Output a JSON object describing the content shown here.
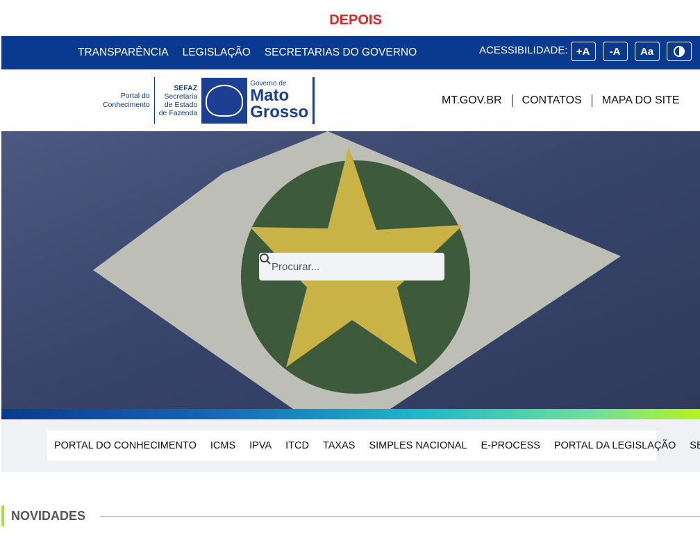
{
  "caption": "DEPOIS",
  "topbar": {
    "links": [
      "TRANSPARÊNCIA",
      "LEGISLAÇÃO",
      "SECRETARIAS DO GOVERNO"
    ],
    "a11y_label": "ACESSIBILIDADE:",
    "a11y_buttons": [
      "+A",
      "-A",
      "Aa"
    ]
  },
  "logo": {
    "portal_line1": "Portal do",
    "portal_line2": "Conhecimento",
    "sefaz_line1": "SEFAZ",
    "sefaz_line2": "Secretaria",
    "sefaz_line3": "de Estado",
    "sefaz_line4": "de Fazenda",
    "gov_small": "Governo de",
    "gov_line1": "Mato",
    "gov_line2": "Grosso"
  },
  "header_links": [
    "MT.GOV.BR",
    "CONTATOS",
    "MAPA DO SITE"
  ],
  "search": {
    "placeholder": "Procurar..."
  },
  "subnav": [
    "PORTAL DO CONHECIMENTO",
    "ICMS",
    "IPVA",
    "ITCD",
    "TAXAS",
    "SIMPLES NACIONAL",
    "E-PROCESS",
    "PORTAL DA LEGISLAÇÃO",
    "SEFAZ"
  ],
  "section": {
    "title": "NOVIDADES"
  },
  "colors": {
    "primary": "#0a3a8f",
    "accent": "#a6e22e"
  }
}
